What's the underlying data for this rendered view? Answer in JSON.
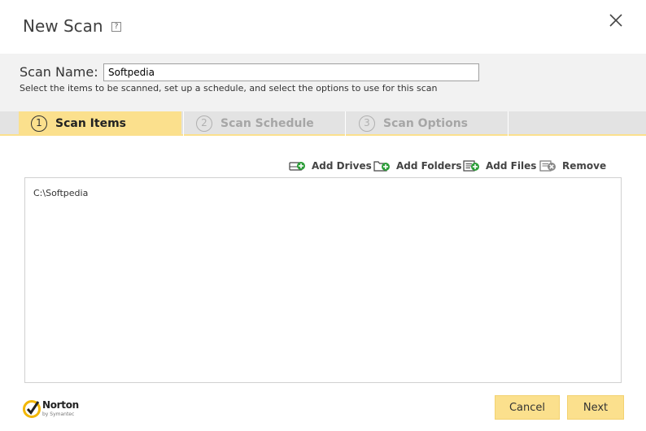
{
  "window": {
    "title": "New Scan",
    "help_label": "?"
  },
  "scan_name": {
    "label": "Scan Name:",
    "value": "Softpedia",
    "hint": "Select the items to be scanned, set up a schedule, and select the options to use for this scan"
  },
  "tabs": [
    {
      "number": "1",
      "label": "Scan Items",
      "active": true
    },
    {
      "number": "2",
      "label": "Scan Schedule",
      "active": false
    },
    {
      "number": "3",
      "label": "Scan Options",
      "active": false
    }
  ],
  "toolbar": {
    "add_drives": "Add Drives",
    "add_folders": "Add Folders",
    "add_files": "Add Files",
    "remove": "Remove"
  },
  "scan_items": [
    "C:\\Softpedia"
  ],
  "footer": {
    "brand": "Norton",
    "brand_sub": "by Symantec",
    "cancel_label": "Cancel",
    "next_label": "Next"
  },
  "colors": {
    "accent": "#fbe08d",
    "tab_inactive_bg": "#e3e3e3",
    "inactive_text": "#a6a6a6",
    "add_green": "#2e9e3a",
    "remove_gray": "#888888"
  }
}
